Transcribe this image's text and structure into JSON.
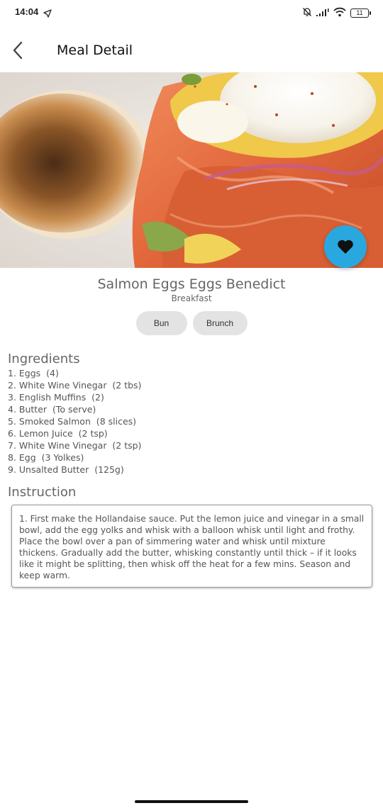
{
  "status_bar": {
    "time": "14:04",
    "battery": "11",
    "icons": [
      "navigation-arrow-icon",
      "mute-bell-icon",
      "signal-icon",
      "wifi-icon",
      "battery-icon"
    ]
  },
  "app_bar": {
    "title": "Meal Detail",
    "back_icon": "chevron-left-icon"
  },
  "meal": {
    "name": "Salmon Eggs Eggs Benedict",
    "category": "Breakfast",
    "image": "eggs-benedict-photo",
    "favorite_icon": "heart-icon",
    "tags": [
      "Bun",
      "Brunch"
    ]
  },
  "ingredients": {
    "title": "Ingredients",
    "items": [
      "1. Eggs  (4)",
      "2. White Wine Vinegar  (2 tbs)",
      "3. English Muffins  (2)",
      "4. Butter  (To serve)",
      "5. Smoked Salmon  (8 slices)",
      "6. Lemon Juice  (2 tsp)",
      "7. White Wine Vinegar  (2 tsp)",
      "8. Egg  (3 Yolkes)",
      "9. Unsalted Butter  (125g)"
    ]
  },
  "instruction": {
    "title": "Instruction",
    "text": "1. First make the Hollandaise sauce. Put the lemon juice and vinegar in a small bowl, add the egg yolks and whisk with a balloon whisk until light and frothy. Place the bowl over a pan of simmering water and whisk until mixture thickens. Gradually add the butter, whisking constantly until thick – if it looks like it might be splitting, then whisk off the heat for a few mins. Season and keep warm."
  },
  "colors": {
    "accent": "#29a8e0",
    "tag_background": "#e3e3e3"
  }
}
